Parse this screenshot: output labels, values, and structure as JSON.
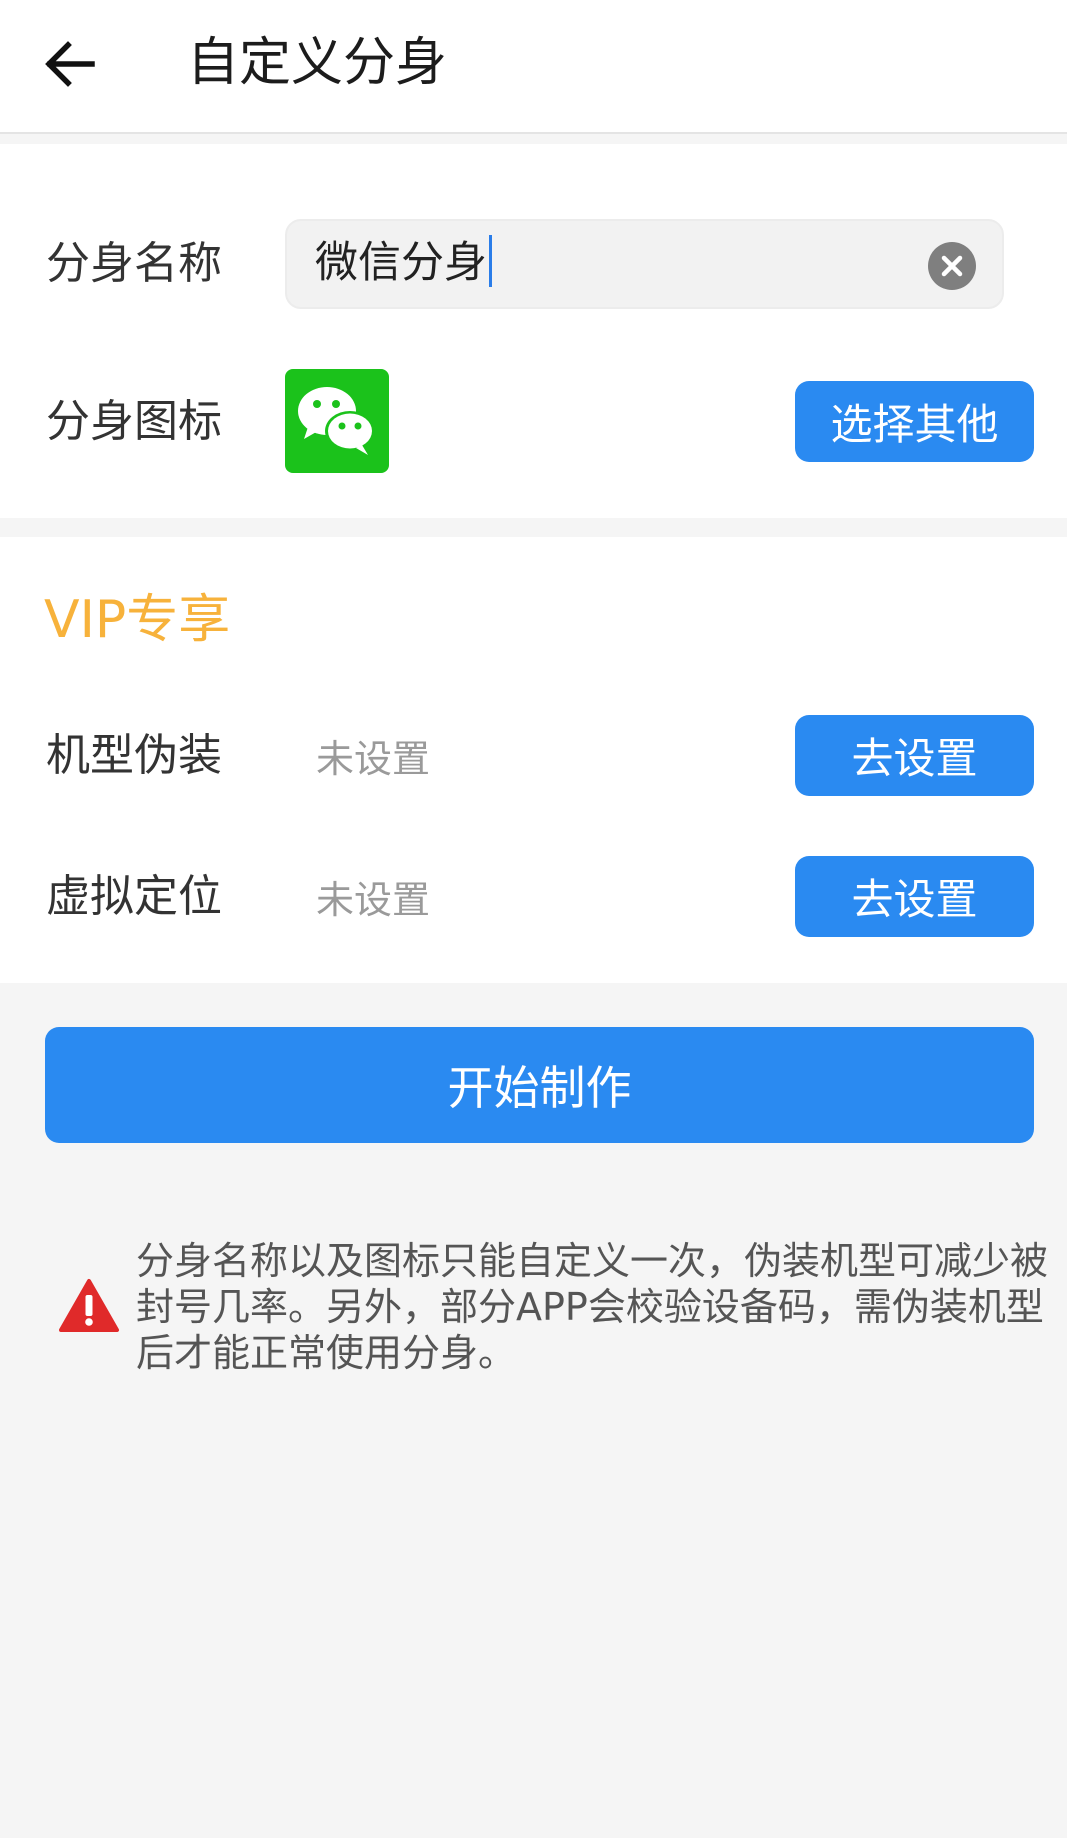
{
  "header": {
    "title": "自定义分身",
    "back_icon": "arrow-left-icon"
  },
  "profile": {
    "name_label": "分身名称",
    "name_value": "微信分身",
    "clear_icon": "clear-circle-icon",
    "icon_label": "分身图标",
    "app_icon": "wechat-icon",
    "choose_other_label": "选择其他"
  },
  "vip": {
    "title": "VIP专享",
    "rows": [
      {
        "label": "机型伪装",
        "status": "未设置",
        "action": "去设置"
      },
      {
        "label": "虚拟定位",
        "status": "未设置",
        "action": "去设置"
      }
    ]
  },
  "start_button": {
    "label": "开始制作"
  },
  "notice": {
    "icon": "warning-icon",
    "text": "分身名称以及图标只能自定义一次，伪装机型可减少被封号几率。另外，部分APP会校验设备码，需伪装机型后才能正常使用分身。"
  },
  "colors": {
    "primary": "#2a8af1",
    "vip": "#f7b23b",
    "wechat_green": "#1bc21b",
    "warning": "#e02a2a"
  }
}
